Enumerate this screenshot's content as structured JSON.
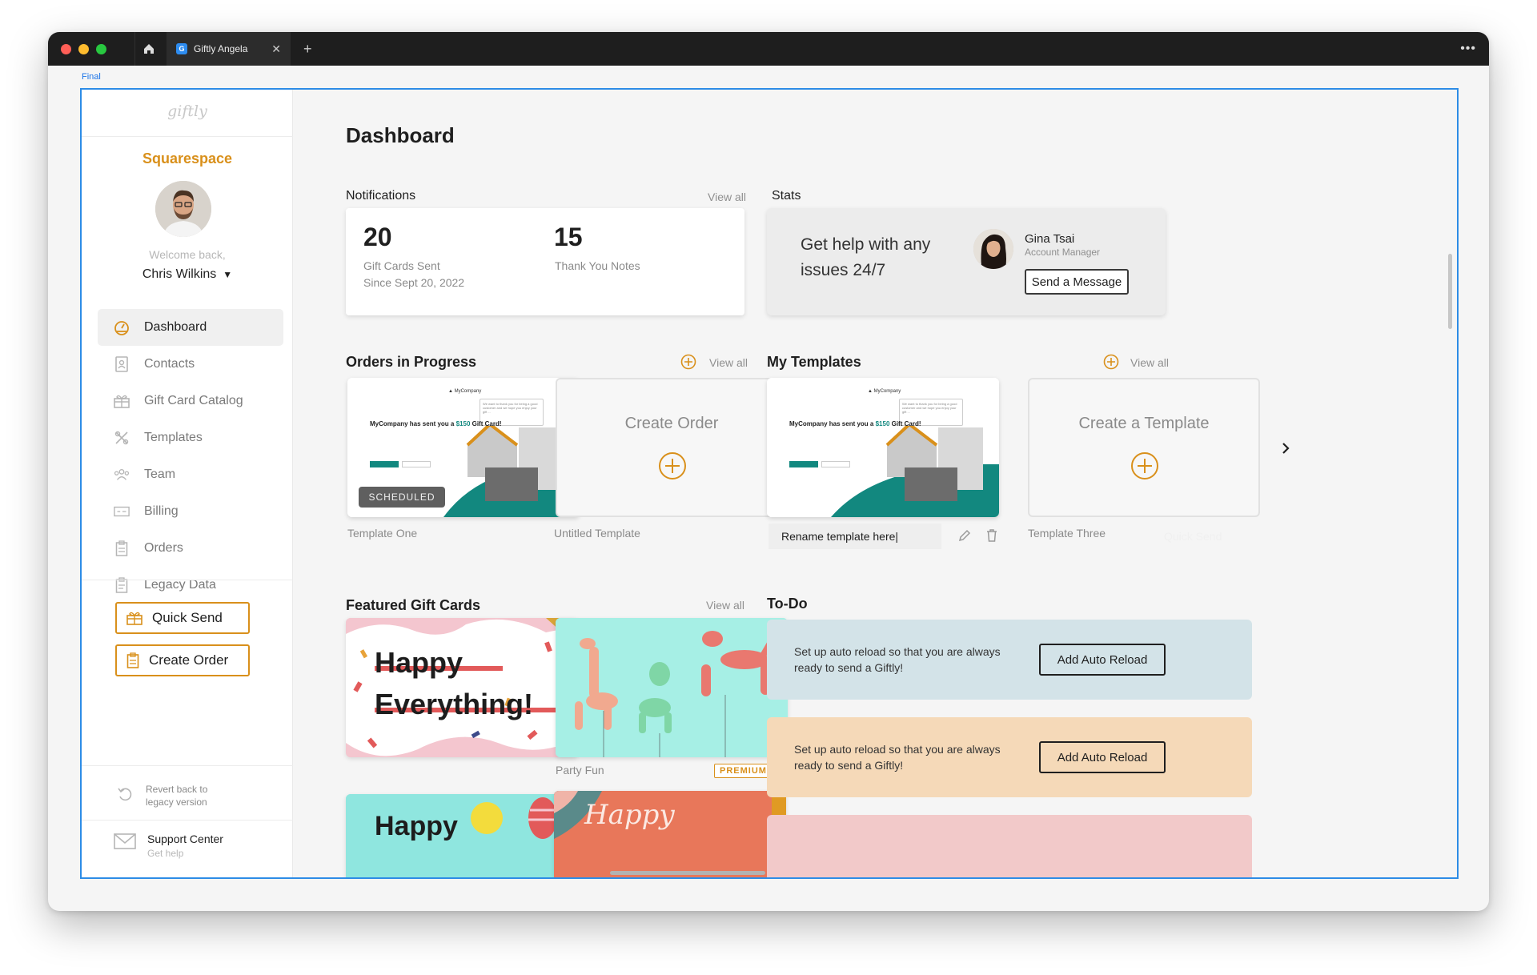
{
  "browser": {
    "tab_title": "Giftly Angela",
    "tab_favicon": "G",
    "frame_label": "Final"
  },
  "sidebar": {
    "logo": "giftly",
    "company": "Squarespace",
    "welcome": "Welcome back,",
    "user_name": "Chris Wilkins",
    "nav": [
      {
        "label": "Dashboard",
        "icon": "dashboard-icon",
        "active": true
      },
      {
        "label": "Contacts",
        "icon": "contacts-icon",
        "active": false
      },
      {
        "label": "Gift Card Catalog",
        "icon": "gift-icon",
        "active": false
      },
      {
        "label": "Templates",
        "icon": "templates-icon",
        "active": false
      },
      {
        "label": "Team",
        "icon": "team-icon",
        "active": false
      },
      {
        "label": "Billing",
        "icon": "billing-icon",
        "active": false
      },
      {
        "label": "Orders",
        "icon": "orders-icon",
        "active": false
      },
      {
        "label": "Legacy Data",
        "icon": "legacy-data-icon",
        "active": false
      }
    ],
    "quick_send": "Quick Send",
    "create_order": "Create Order",
    "revert_line1": "Revert back to",
    "revert_line2": "legacy version",
    "support_title": "Support Center",
    "support_sub": "Get help"
  },
  "main": {
    "title": "Dashboard",
    "notifications": {
      "title": "Notifications",
      "view_all": "View all",
      "gift_cards_count": "20",
      "gift_cards_label": "Gift Cards Sent",
      "gift_cards_since": "Since Sept 20, 2022",
      "thank_you_count": "15",
      "thank_you_label": "Thank You Notes"
    },
    "stats": {
      "title": "Stats",
      "help_text": "Get help with any issues 24/7",
      "manager_name": "Gina Tsai",
      "manager_role": "Account Manager",
      "message_button": "Send a Message"
    },
    "orders": {
      "title": "Orders in Progress",
      "view_all": "View all",
      "order_one_caption": "Template One",
      "status_badge": "SCHEDULED",
      "create_label": "Create Order",
      "create_caption": "Untitled Template"
    },
    "mini_card": {
      "company": "▲ MyCompany",
      "headline_pre": "MyCompany has sent you a ",
      "headline_amount": "$150",
      "headline_post": " Gift Card!",
      "note": "We want to thank you for being a good customer and we hope you enjoy your gift ..."
    },
    "templates": {
      "title": "My Templates",
      "view_all": "View all",
      "rename_value": "Rename template here|",
      "create_label": "Create a Template",
      "create_caption": "Template Three",
      "ghost_text": "Quick Send"
    },
    "featured": {
      "title": "Featured Gift Cards",
      "view_all": "View all",
      "card1_line1": "Happy",
      "card1_line2": "Everything!",
      "card2_caption": "Party Fun",
      "card2_badge": "PREMIUM",
      "card3_text": "Happy",
      "card4_text": "Happy"
    },
    "todo": {
      "title": "To-Do",
      "items": [
        {
          "text": "Set up auto reload so that you are always ready to send a Giftly!",
          "button": "Add Auto Reload",
          "color": "#d3e3e8"
        },
        {
          "text": "Set up auto reload so that you are always ready to send a Giftly!",
          "button": "Add Auto Reload",
          "color": "#f5d9b8"
        }
      ],
      "third_color": "#f2c9c9"
    }
  },
  "colors": {
    "accent": "#d9901b",
    "teal": "#12887f",
    "frame_border": "#2d8ce6"
  }
}
